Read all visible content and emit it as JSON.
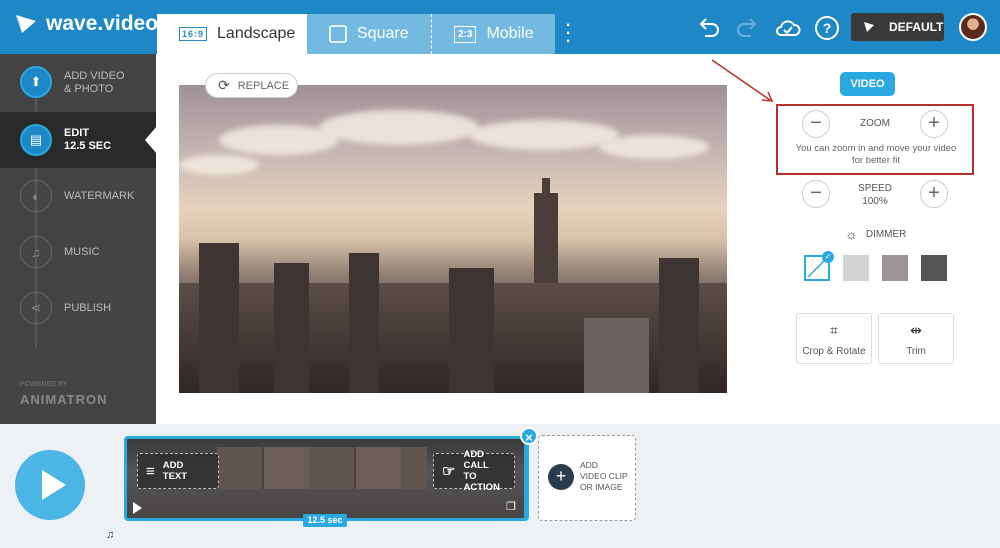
{
  "app": {
    "name": "wave.video"
  },
  "tabs": [
    {
      "label": "Landscape",
      "badge": "16:9"
    },
    {
      "label": "Square"
    },
    {
      "label": "Mobile",
      "badge": "2:3"
    }
  ],
  "topbar": {
    "default_label": "DEFAULT"
  },
  "sidebar": {
    "items": [
      {
        "label_line1": "ADD VIDEO",
        "label_line2": "& PHOTO"
      },
      {
        "label_line1": "EDIT",
        "label_line2": "12.5 sec"
      },
      {
        "label_line1": "WATERMARK"
      },
      {
        "label_line1": "MUSIC"
      },
      {
        "label_line1": "PUBLISH"
      }
    ],
    "powered_by": "POWERED BY",
    "brand": "ANIMATRON"
  },
  "main": {
    "replace_label": "REPLACE"
  },
  "panel": {
    "video_pill": "VIDEO",
    "zoom_label": "ZOOM",
    "zoom_hint_line1": "You can zoom in and move your video",
    "zoom_hint_line2": "for better fit",
    "speed_label": "SPEED",
    "speed_value": "100%",
    "dimmer_label": "DIMMER",
    "crop_label": "Crop & Rotate",
    "trim_label": "Trim"
  },
  "timeline": {
    "add_text_line1": "ADD",
    "add_text_line2": "TEXT",
    "add_cta_line1": "ADD CALL",
    "add_cta_line2": "TO ACTION",
    "clip_duration": "12.5 sec",
    "add_clip_line1": "ADD",
    "add_clip_line2": "VIDEO CLIP",
    "add_clip_line3": "OR IMAGE"
  },
  "colors": {
    "brand_blue": "#1e88c7",
    "accent_blue": "#2aa8e0",
    "highlight_red": "#b5322a",
    "sidebar_bg": "#444444"
  }
}
